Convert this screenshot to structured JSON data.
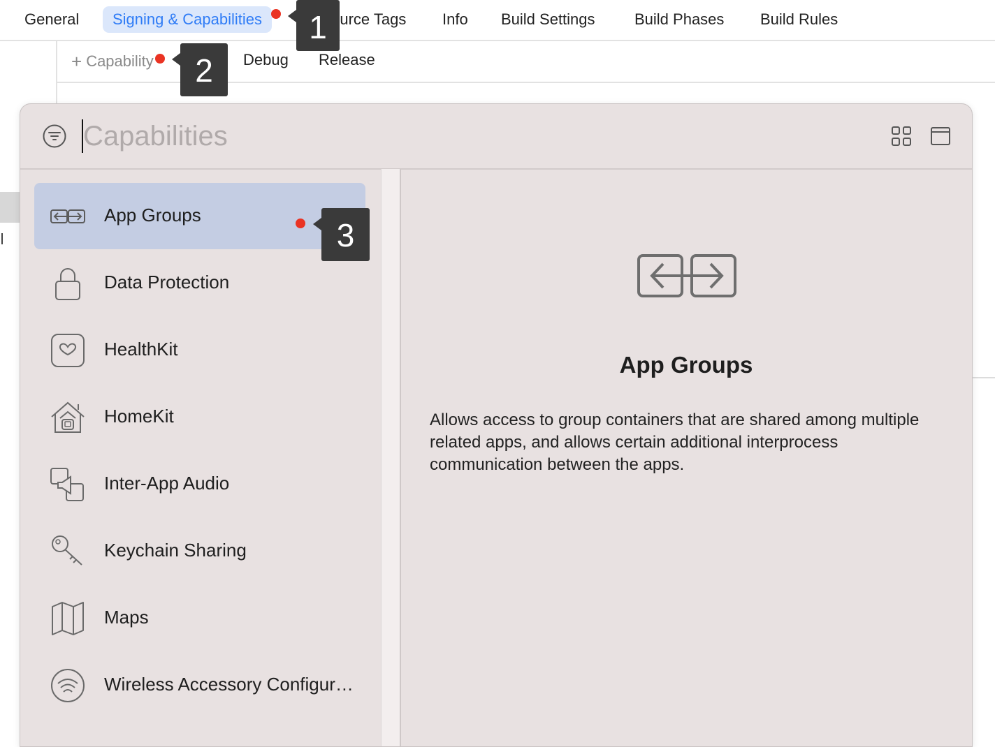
{
  "tabs": [
    "General",
    "Signing & Capabilities",
    "Resource Tags",
    "Info",
    "Build Settings",
    "Build Phases",
    "Build Rules"
  ],
  "active_tab": "Signing & Capabilities",
  "toolbar": {
    "add_capability": "Capability",
    "debug": "Debug",
    "release": "Release"
  },
  "popover": {
    "search_placeholder": "Capabilities",
    "capabilities": [
      {
        "label": "App Groups",
        "icon": "app-groups-icon",
        "selected": true
      },
      {
        "label": "Data Protection",
        "icon": "lock-icon"
      },
      {
        "label": "HealthKit",
        "icon": "health-heart-icon"
      },
      {
        "label": "HomeKit",
        "icon": "home-icon"
      },
      {
        "label": "Inter-App Audio",
        "icon": "inter-app-audio-icon"
      },
      {
        "label": "Keychain Sharing",
        "icon": "key-icon"
      },
      {
        "label": "Maps",
        "icon": "map-icon"
      },
      {
        "label": "Wireless Accessory Configur…",
        "icon": "wireless-icon"
      }
    ],
    "detail": {
      "title": "App Groups",
      "description": "Allows access to group containers that are shared among multiple related apps, and allows certain additional interprocess communication between the apps."
    }
  },
  "markers": [
    "1",
    "2",
    "3"
  ],
  "colors": {
    "accent": "#2f7cf6",
    "active_tab_bg": "#dbe7fb",
    "selected_row": "#c4cde3",
    "popover_bg": "#e8e1e1",
    "marker_dot": "#ea3323",
    "badge_bg": "#3a3a3a"
  }
}
